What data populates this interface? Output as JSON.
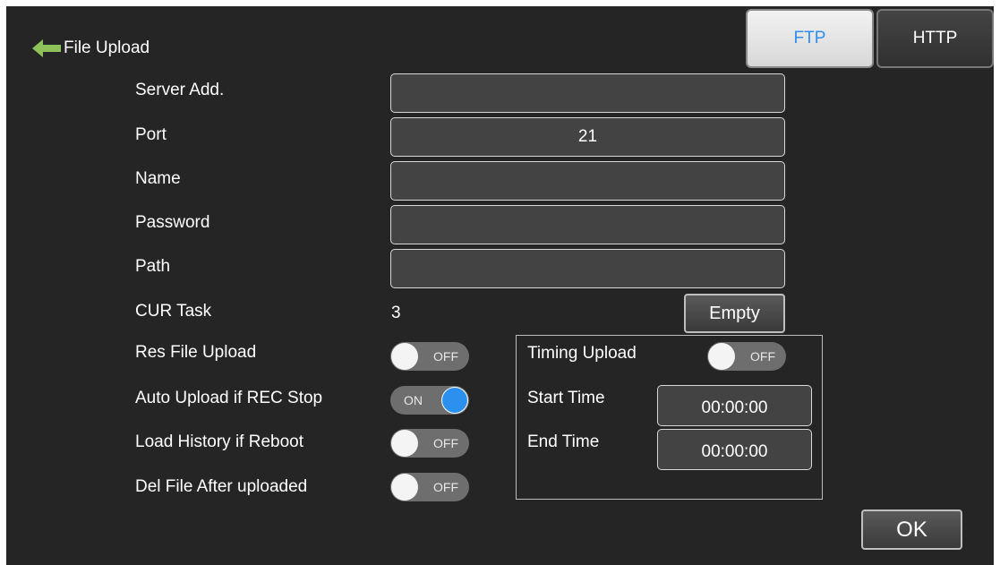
{
  "header": {
    "back_icon": "left-arrow-icon",
    "back_color": "#8fc15b",
    "title": "File Upload"
  },
  "tabs": [
    {
      "label": "FTP",
      "active": true
    },
    {
      "label": "HTTP",
      "active": false
    }
  ],
  "form": {
    "server": {
      "label": "Server Add.",
      "value": ""
    },
    "port": {
      "label": "Port",
      "value": "21"
    },
    "name": {
      "label": "Name",
      "value": ""
    },
    "password": {
      "label": "Password",
      "value": ""
    },
    "path": {
      "label": "Path",
      "value": ""
    }
  },
  "cur_task": {
    "label": "CUR Task",
    "value": "3",
    "empty_button": "Empty"
  },
  "toggles": [
    {
      "label": "Res File Upload",
      "state": "OFF"
    },
    {
      "label": "Auto Upload if REC Stop",
      "state": "ON"
    },
    {
      "label": "Load History if Reboot",
      "state": "OFF"
    },
    {
      "label": "Del File After uploaded",
      "state": "OFF"
    }
  ],
  "timing": {
    "label": "Timing Upload",
    "state": "OFF",
    "start_label": "Start Time",
    "start_value": "00:00:00",
    "end_label": "End Time",
    "end_value": "00:00:00"
  },
  "ok_button": "OK",
  "colors": {
    "active_tab_text": "#2f8df0",
    "toggle_on_knob": "#2c90ef",
    "background": "#252525"
  }
}
